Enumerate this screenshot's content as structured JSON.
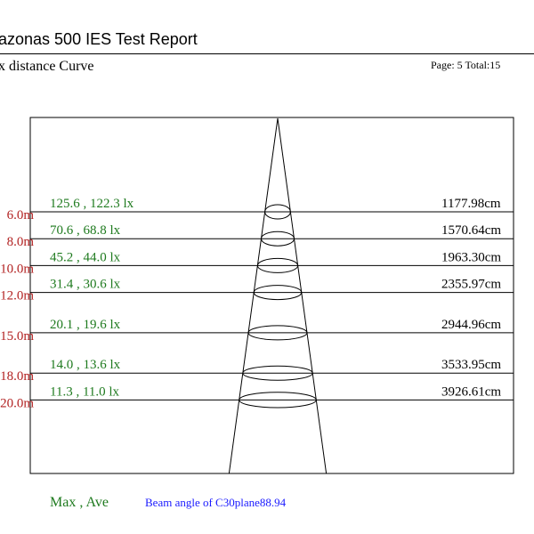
{
  "header": {
    "title": "azonas 500 IES Test Report",
    "chart_title": "x distance Curve",
    "page_info": "Page: 5  Total:15"
  },
  "footer": {
    "max_ave_label": "Max , Ave",
    "beam_angle_text": "Beam angle of C30plane88.94"
  },
  "colors": {
    "distance_label": "#b22222",
    "lux_label": "#1e7a1e",
    "beam_angle": "#1a1aff",
    "lines": "#000000"
  },
  "chart_data": {
    "type": "diagram",
    "beam_angle_deg": 88.94,
    "plane": "C30",
    "rows": [
      {
        "distance_label": "6.0m",
        "distance_m": 6,
        "lux_label": "125.6 , 122.3 lx",
        "max_lx": 125.6,
        "ave_lx": 122.3,
        "diameter_label": "1177.98cm",
        "diameter_cm": 1177.98
      },
      {
        "distance_label": "8.0m",
        "distance_m": 8,
        "lux_label": "70.6 , 68.8 lx",
        "max_lx": 70.6,
        "ave_lx": 68.8,
        "diameter_label": "1570.64cm",
        "diameter_cm": 1570.64
      },
      {
        "distance_label": "10.0m",
        "distance_m": 10,
        "lux_label": "45.2 , 44.0 lx",
        "max_lx": 45.2,
        "ave_lx": 44.0,
        "diameter_label": "1963.30cm",
        "diameter_cm": 1963.3
      },
      {
        "distance_label": "12.0m",
        "distance_m": 12,
        "lux_label": "31.4 , 30.6 lx",
        "max_lx": 31.4,
        "ave_lx": 30.6,
        "diameter_label": "2355.97cm",
        "diameter_cm": 2355.97
      },
      {
        "distance_label": "15.0m",
        "distance_m": 15,
        "lux_label": "20.1 , 19.6 lx",
        "max_lx": 20.1,
        "ave_lx": 19.6,
        "diameter_label": "2944.96cm",
        "diameter_cm": 2944.96
      },
      {
        "distance_label": "18.0m",
        "distance_m": 18,
        "lux_label": "14.0 , 13.6 lx",
        "max_lx": 14.0,
        "ave_lx": 13.6,
        "diameter_label": "3533.95cm",
        "diameter_cm": 3533.95
      },
      {
        "distance_label": "20.0m",
        "distance_m": 20,
        "lux_label": "11.3 , 11.0 lx",
        "max_lx": 11.3,
        "ave_lx": 11.0,
        "diameter_label": "3926.61cm",
        "diameter_cm": 3926.61
      }
    ]
  }
}
